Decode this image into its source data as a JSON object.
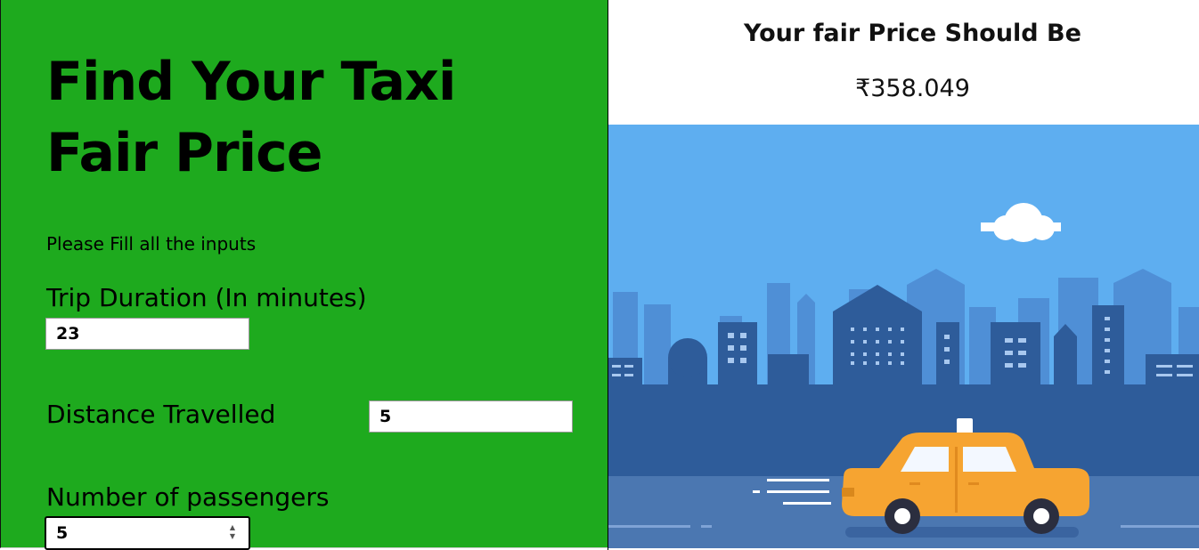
{
  "form": {
    "title": "Find Your Taxi Fair Price",
    "instruction": "Please Fill all the inputs",
    "trip_duration": {
      "label": "Trip Duration (In minutes)",
      "value": "23"
    },
    "distance": {
      "label": "Distance Travelled",
      "value": "5"
    },
    "passengers": {
      "label": "Number of passengers",
      "value": "5"
    }
  },
  "result": {
    "heading": "Your fair Price Should Be",
    "price": "₹358.049"
  },
  "illustration": {
    "name": "city-taxi-illustration",
    "colors": {
      "sky": "#5eaef0",
      "buildings_back": "#4f8fd6",
      "buildings_front": "#2e5c9a",
      "road": "#4b77b1",
      "taxi": "#f6a431",
      "tires": "#2b2e3f"
    }
  },
  "colors": {
    "panel_bg": "#1eaa1e",
    "text": "#000000"
  }
}
